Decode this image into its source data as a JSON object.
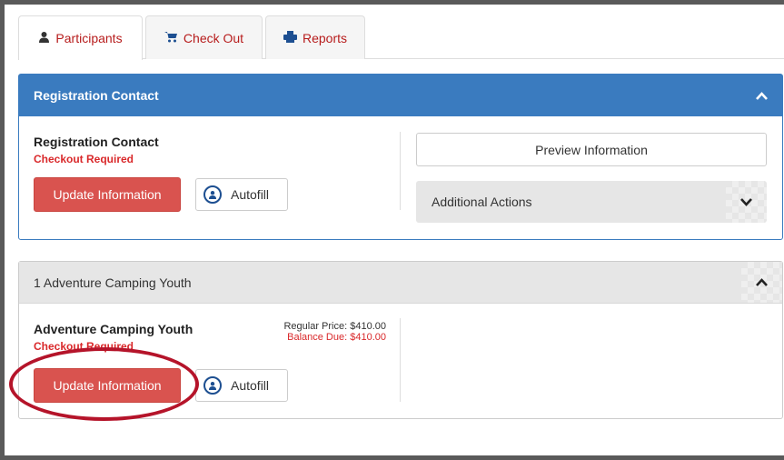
{
  "tabs": [
    {
      "label": "Participants",
      "icon": "user-icon",
      "active": true
    },
    {
      "label": "Check Out",
      "icon": "cart-icon",
      "active": false
    },
    {
      "label": "Reports",
      "icon": "reports-icon",
      "active": false
    }
  ],
  "contact_panel": {
    "header": "Registration Contact",
    "title": "Registration Contact",
    "status": "Checkout Required",
    "update_label": "Update Information",
    "autofill_label": "Autofill",
    "preview_label": "Preview Information",
    "actions_label": "Additional Actions"
  },
  "participant_panel": {
    "header": "1 Adventure Camping Youth",
    "title": "Adventure Camping Youth",
    "status": "Checkout Required",
    "regular_price": "Regular Price:  $410.00",
    "balance_due": "Balance Due:  $410.00",
    "update_label": "Update Information",
    "autofill_label": "Autofill"
  },
  "colors": {
    "accent_blue": "#3a7bbf",
    "button_red": "#d9534f",
    "highlight_oval": "#b5142a",
    "required_text": "#d9282a"
  }
}
